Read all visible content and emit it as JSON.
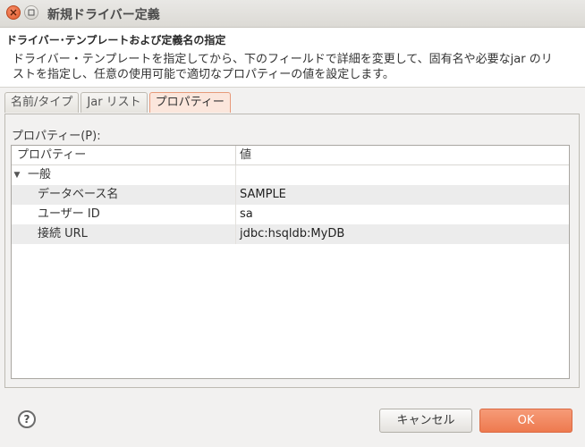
{
  "window": {
    "title": "新規ドライバー定義"
  },
  "header": {
    "title": "ドライバー･テンプレートおよび定義名の指定",
    "description": "ドライバー・テンプレートを指定してから、下のフィールドで詳細を変更して、固有名や必要なjar のリストを指定し、任意の使用可能で適切なプロパティーの値を設定します。"
  },
  "tabs": [
    {
      "label": "名前/タイプ",
      "active": false
    },
    {
      "label": "Jar リスト",
      "active": false
    },
    {
      "label": "プロパティー",
      "active": true
    }
  ],
  "properties": {
    "label": "プロパティー(P):",
    "columns": [
      "プロパティー",
      "値"
    ],
    "group": {
      "name": "一般",
      "expanded_glyph": "▼"
    },
    "rows": [
      {
        "name": "データベース名",
        "value": "SAMPLE"
      },
      {
        "name": "ユーザー ID",
        "value": "sa"
      },
      {
        "name": "接続 URL",
        "value": "jdbc:hsqldb:MyDB"
      }
    ]
  },
  "footer": {
    "help_glyph": "?",
    "cancel_label": "キャンセル",
    "ok_label": "OK"
  },
  "colors": {
    "accent": "#ee7a4f",
    "active_tab": "#fbe6dc"
  }
}
